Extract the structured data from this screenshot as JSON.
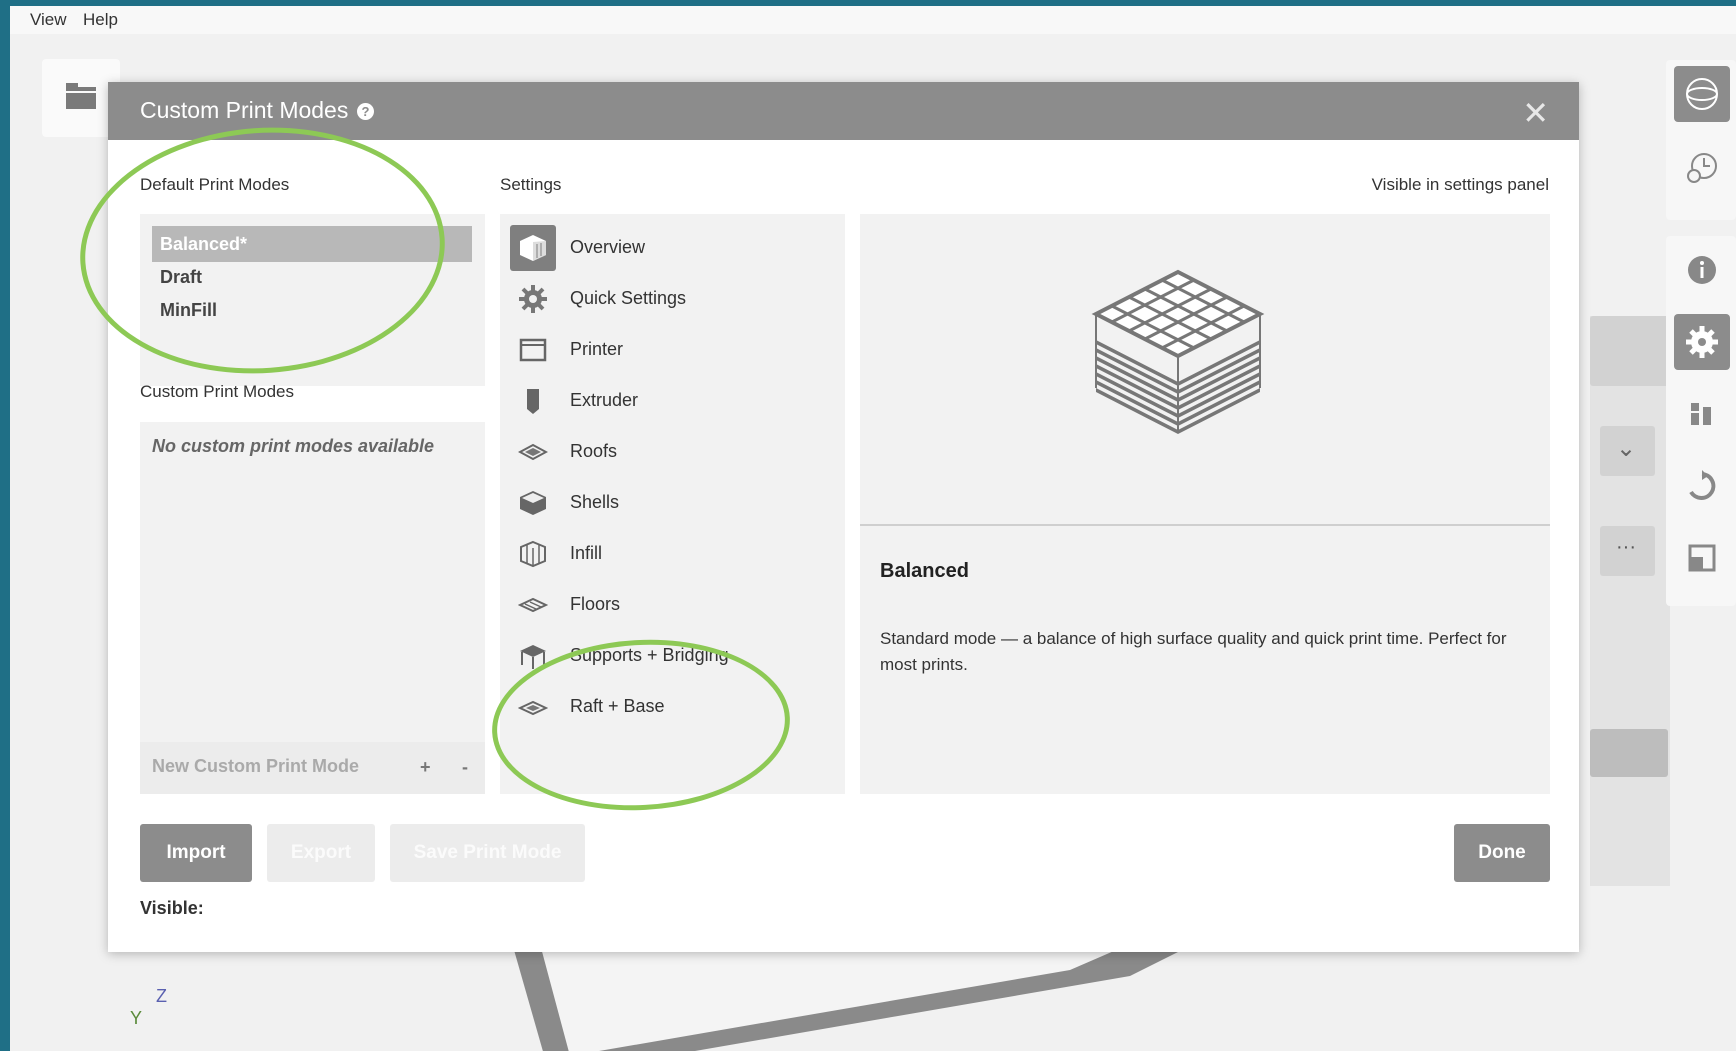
{
  "menubar": {
    "items": [
      "View",
      "Help"
    ]
  },
  "dialog": {
    "title": "Custom Print Modes",
    "default_modes_label": "Default Print Modes",
    "default_modes": [
      {
        "label": "Balanced*",
        "selected": true
      },
      {
        "label": "Draft",
        "selected": false
      },
      {
        "label": "MinFill",
        "selected": false
      }
    ],
    "custom_modes_label": "Custom Print Modes",
    "no_custom_modes_text": "No custom print modes available",
    "new_custom_mode_label": "New Custom Print Mode",
    "add_symbol": "+",
    "remove_symbol": "-",
    "settings_label": "Settings",
    "visible_label": "Visible in settings panel",
    "settings": [
      {
        "label": "Overview",
        "icon": "overview-icon",
        "active": true
      },
      {
        "label": "Quick Settings",
        "icon": "gear-icon",
        "active": false
      },
      {
        "label": "Printer",
        "icon": "printer-icon",
        "active": false
      },
      {
        "label": "Extruder",
        "icon": "extruder-icon",
        "active": false
      },
      {
        "label": "Roofs",
        "icon": "roofs-icon",
        "active": false
      },
      {
        "label": "Shells",
        "icon": "shells-icon",
        "active": false
      },
      {
        "label": "Infill",
        "icon": "infill-icon",
        "active": false
      },
      {
        "label": "Floors",
        "icon": "floors-icon",
        "active": false
      },
      {
        "label": "Supports + Bridging",
        "icon": "supports-icon",
        "active": false
      },
      {
        "label": "Raft + Base",
        "icon": "raft-icon",
        "active": false
      }
    ],
    "preview": {
      "name": "Balanced",
      "description": "Standard mode — a balance of high surface quality and quick print time. Perfect for most prints."
    },
    "buttons": {
      "import": "Import",
      "export": "Export",
      "save": "Save Print Mode",
      "done": "Done"
    },
    "visible_footer": "Visible:"
  },
  "axes": {
    "z": "Z",
    "y": "Y"
  },
  "colors": {
    "header": "#8c8c8c",
    "annotation": "#8dc955",
    "background": "#1f6f86"
  }
}
